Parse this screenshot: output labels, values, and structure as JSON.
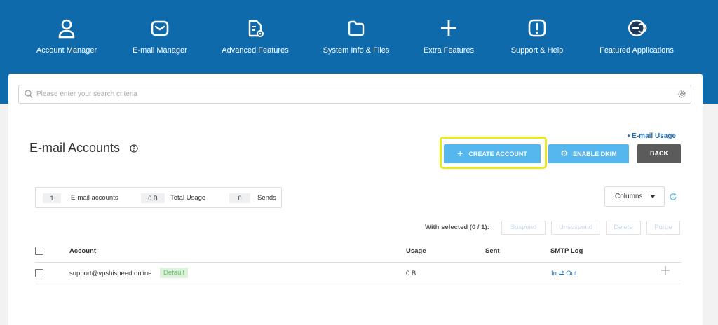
{
  "nav": {
    "items": [
      {
        "label": "Account Manager",
        "icon": "user-icon"
      },
      {
        "label": "E-mail Manager",
        "icon": "envelope-icon"
      },
      {
        "label": "Advanced Features",
        "icon": "file-gear-icon"
      },
      {
        "label": "System Info & Files",
        "icon": "folder-icon"
      },
      {
        "label": "Extra Features",
        "icon": "plus-icon"
      },
      {
        "label": "Support & Help",
        "icon": "alert-icon"
      },
      {
        "label": "Featured Applications",
        "icon": "app-icon"
      }
    ]
  },
  "search": {
    "placeholder": "Please enter your search criteria"
  },
  "page": {
    "title": "E-mail Accounts",
    "usage_link": "• E-mail Usage",
    "buttons": {
      "create": "CREATE ACCOUNT",
      "dkim": "ENABLE DKIM",
      "back": "BACK"
    }
  },
  "stats": {
    "accounts_count": "1",
    "accounts_label": "E-mail accounts",
    "usage_value": "0 B",
    "usage_label": "Total Usage",
    "sends_count": "0",
    "sends_label": "Sends"
  },
  "columns_label": "Columns",
  "with_selected": "With selected (0 / 1):",
  "bulk": {
    "suspend": "Suspend",
    "unsuspend": "Unsuspend",
    "delete": "Delete",
    "purge": "Purge"
  },
  "table": {
    "headers": {
      "account": "Account",
      "usage": "Usage",
      "sent": "Sent",
      "smtp": "SMTP Log"
    },
    "rows": [
      {
        "account": "support@vpshispeed.online",
        "badge": "Default",
        "usage": "0 B",
        "sent": "",
        "smtp_in": "In",
        "smtp_arrow": "⇄",
        "smtp_out": "Out"
      }
    ]
  },
  "colors": {
    "header_bg": "#0f6aab",
    "primary": "#56b7ef",
    "highlight": "#e6ea25",
    "back": "#5b5b5b",
    "link": "#1f6fb2"
  }
}
